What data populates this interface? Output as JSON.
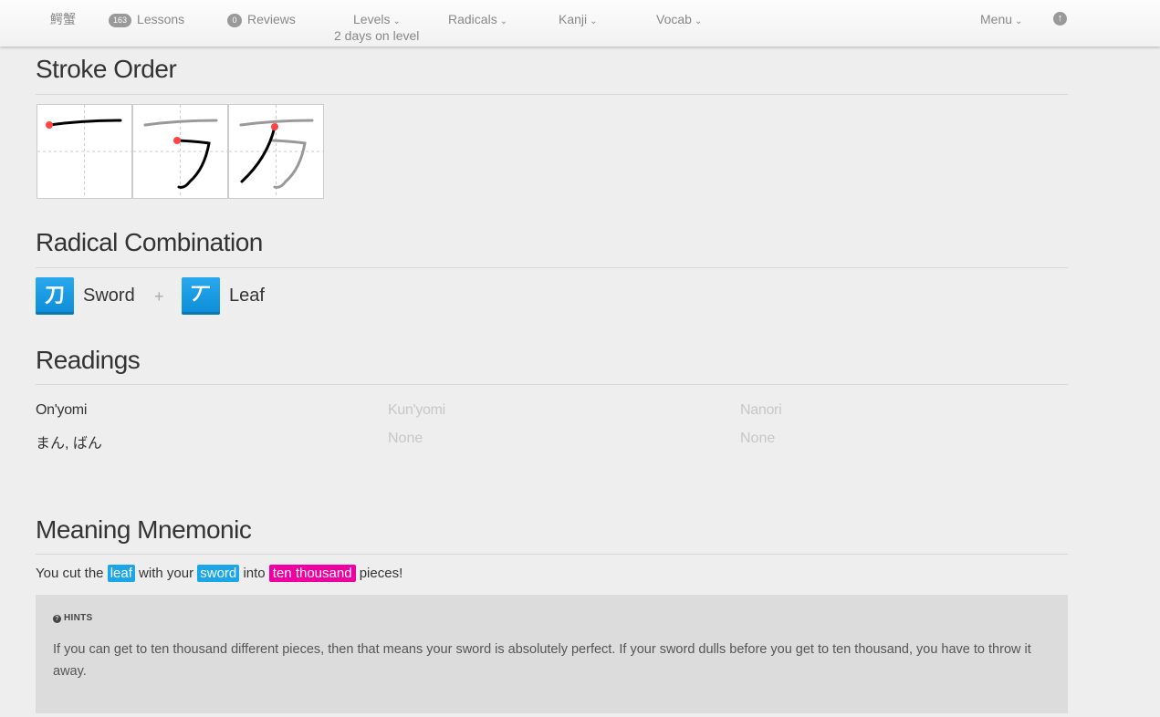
{
  "nav": {
    "user": "鰐蟹",
    "lessons_count": "163",
    "lessons_label": "Lessons",
    "reviews_count": "0",
    "reviews_label": "Reviews",
    "levels_label": "Levels",
    "levels_note": "2 days on level",
    "radicals_label": "Radicals",
    "kanji_label": "Kanji",
    "vocab_label": "Vocab",
    "menu_label": "Menu",
    "chevron_icon": "chevron-down-icon",
    "upload_icon": "arrow-up-circle-icon"
  },
  "stroke_order": {
    "title": "Stroke Order",
    "frames": 3
  },
  "radical_combination": {
    "title": "Radical Combination",
    "plus": "+",
    "radicals": [
      {
        "character": "刀",
        "name": "Sword"
      },
      {
        "character": "丆",
        "name": "Leaf"
      }
    ],
    "color": "#1ba6ea"
  },
  "readings": {
    "title": "Readings",
    "onyomi_label": "On'yomi",
    "onyomi_value": "まん, ばん",
    "kunyomi_label": "Kun'yomi",
    "kunyomi_value": "None",
    "nanori_label": "Nanori",
    "nanori_value": "None"
  },
  "meaning_mnemonic": {
    "title": "Meaning Mnemonic",
    "text_1": "You cut the",
    "hl_leaf": "leaf",
    "text_2": "with your",
    "hl_sword": "sword",
    "text_3": "into",
    "hl_kanji": "ten thousand",
    "text_4": "pieces!",
    "kanji_color": "#f100a1"
  },
  "hints": {
    "label": "HINTS",
    "icon": "question-circle-icon",
    "text": "If you can get to ten thousand different pieces, then that means your sword is absolutely perfect. If your sword dulls before you get to ten thousand, you have to throw it away."
  }
}
